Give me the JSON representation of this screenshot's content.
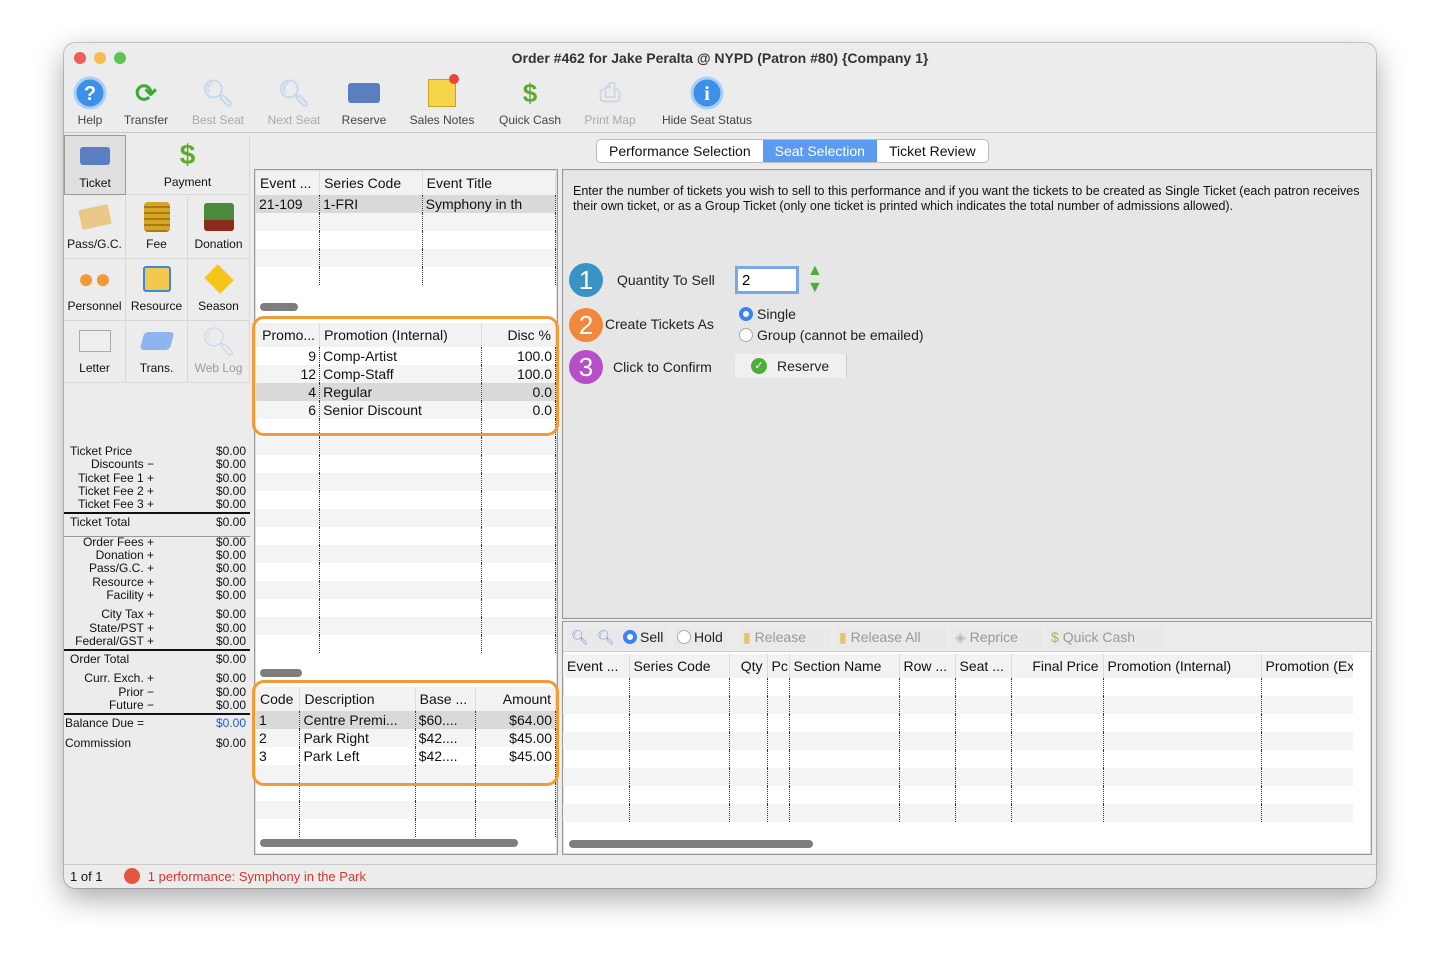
{
  "window": {
    "title": "Order #462 for Jake Peralta @ NYPD (Patron #80) {Company 1}"
  },
  "toolbar": [
    {
      "label": "Help",
      "icon": "help-icon",
      "enabled": true
    },
    {
      "label": "Transfer",
      "icon": "transfer-icon",
      "enabled": true
    },
    {
      "label": "Best Seat",
      "icon": "magnifier-icon",
      "enabled": false
    },
    {
      "label": "Next Seat",
      "icon": "magnifier-plus-icon",
      "enabled": false
    },
    {
      "label": "Reserve",
      "icon": "ticket-icon",
      "enabled": true
    },
    {
      "label": "Sales Notes",
      "icon": "note-icon",
      "enabled": true
    },
    {
      "label": "Quick Cash",
      "icon": "dollar-icon",
      "enabled": true
    },
    {
      "label": "Print Map",
      "icon": "printer-icon",
      "enabled": false
    },
    {
      "label": "Hide Seat Status",
      "icon": "info-icon",
      "enabled": true
    }
  ],
  "sidebar": {
    "buttons": [
      {
        "label": "Ticket",
        "icon": "ticket-icon"
      },
      {
        "label": "Payment",
        "icon": "dollar-icon"
      },
      {
        "label": "Pass/G.C.",
        "icon": "gift-card-icon"
      },
      {
        "label": "Fee",
        "icon": "coins-icon"
      },
      {
        "label": "Donation",
        "icon": "cash-icon"
      },
      {
        "label": "Personnel",
        "icon": "people-icon"
      },
      {
        "label": "Resource",
        "icon": "resource-icon"
      },
      {
        "label": "Season",
        "icon": "box-icon"
      },
      {
        "label": "Letter",
        "icon": "letter-icon"
      },
      {
        "label": "Trans.",
        "icon": "transaction-icon"
      },
      {
        "label": "Web Log",
        "icon": "web-log-icon"
      }
    ],
    "totals": [
      {
        "label": "Ticket Price",
        "value": "$0.00"
      },
      {
        "label": "Discounts −",
        "value": "$0.00"
      },
      {
        "label": "Ticket Fee 1 +",
        "value": "$0.00"
      },
      {
        "label": "Ticket Fee 2 +",
        "value": "$0.00"
      },
      {
        "label": "Ticket Fee 3 +",
        "value": "$0.00"
      },
      {
        "label": "Ticket Total",
        "value": "$0.00"
      },
      {
        "label": "Order Fees +",
        "value": "$0.00"
      },
      {
        "label": "Donation +",
        "value": "$0.00"
      },
      {
        "label": "Pass/G.C. +",
        "value": "$0.00"
      },
      {
        "label": "Resource +",
        "value": "$0.00"
      },
      {
        "label": "Facility +",
        "value": "$0.00"
      },
      {
        "label": "City Tax +",
        "value": "$0.00"
      },
      {
        "label": "State/PST +",
        "value": "$0.00"
      },
      {
        "label": "Federal/GST +",
        "value": "$0.00"
      },
      {
        "label": "Order Total",
        "value": "$0.00"
      },
      {
        "label": "Curr. Exch. +",
        "value": "$0.00"
      },
      {
        "label": "Prior −",
        "value": "$0.00"
      },
      {
        "label": "Future −",
        "value": "$0.00"
      },
      {
        "label": "Balance Due =",
        "value": "$0.00"
      },
      {
        "label": "Commission",
        "value": "$0.00"
      }
    ]
  },
  "events": {
    "headers": [
      "Event ...",
      "Series Code",
      "Event Title"
    ],
    "rows": [
      [
        "21-109",
        "1-FRI",
        "Symphony in th"
      ]
    ]
  },
  "promotions": {
    "headers": [
      "Promo...",
      "Promotion (Internal)",
      "Disc %"
    ],
    "rows": [
      [
        "9",
        "Comp-Artist",
        "100.0"
      ],
      [
        "12",
        "Comp-Staff",
        "100.0"
      ],
      [
        "4",
        "Regular",
        "0.0"
      ],
      [
        "6",
        "Senior Discount",
        "0.0"
      ]
    ]
  },
  "prices": {
    "headers": [
      "Code",
      "Description",
      "Base ...",
      "Amount"
    ],
    "rows": [
      [
        "1",
        "Centre Premi...",
        "$60....",
        "$64.00"
      ],
      [
        "2",
        "Park Right",
        "$42....",
        "$45.00"
      ],
      [
        "3",
        "Park Left",
        "$42....",
        "$45.00"
      ]
    ]
  },
  "tabs": [
    "Performance Selection",
    "Seat Selection",
    "Ticket Review"
  ],
  "active_tab": "Seat Selection",
  "seat": {
    "instructions": "Enter the number of tickets you wish to sell to this performance and if you want the tickets to be created as Single Ticket (each patron receives their own ticket, or as a Group Ticket (only one ticket is printed which indicates the total number of admissions allowed).",
    "step1_label": "Quantity To Sell",
    "quantity": "2",
    "step2_label": "Create Tickets As",
    "opt_single": "Single",
    "opt_group": "Group (cannot be emailed)",
    "selected": "Single",
    "step3_label": "Click to Confirm",
    "reserve_label": "Reserve"
  },
  "bottom": {
    "sell": "Sell",
    "hold": "Hold",
    "release": "Release",
    "release_all": "Release All",
    "reprice": "Reprice",
    "quick_cash": "Quick Cash",
    "headers": [
      "Event ...",
      "Series Code",
      "Qty",
      "Pc",
      "Section Name",
      "Row ...",
      "Seat ...",
      "Final Price",
      "Promotion (Internal)",
      "Promotion (Ex"
    ]
  },
  "status": {
    "page": "1 of 1",
    "message": "1 performance: Symphony in the Park"
  }
}
